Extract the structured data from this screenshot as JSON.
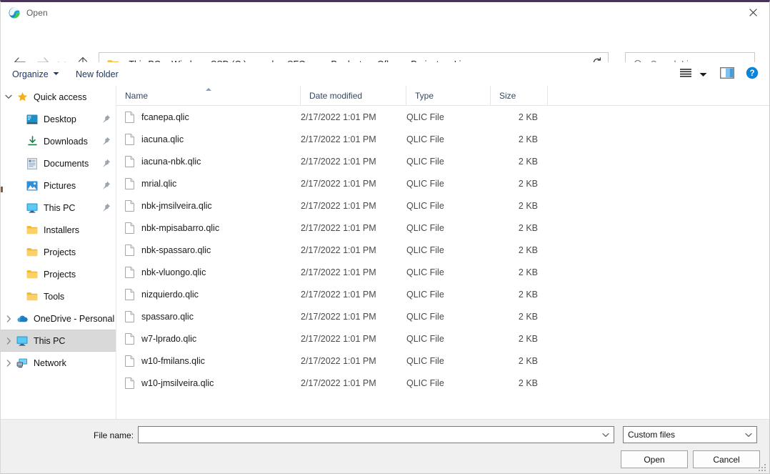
{
  "window": {
    "title": "Open",
    "app_icon": "edge-icon",
    "close_label": "✕"
  },
  "nav": {
    "back_icon": "back-arrow-icon",
    "forward_icon": "forward-arrow-icon",
    "recent_icon": "chevron-down-icon",
    "up_icon": "up-arrow-icon"
  },
  "address": {
    "folder_icon": "folder-icon",
    "crumbs": [
      "This PC",
      "Windows-SSD (C:)",
      "work",
      "SFQexp",
      "Products",
      "Qflow",
      "Projects",
      "Licenses"
    ],
    "separator": "›",
    "dropdown_icon": "chevron-down-icon",
    "refresh_icon": "refresh-icon"
  },
  "search": {
    "placeholder": "Search Licenses",
    "icon": "search-icon"
  },
  "commandbar": {
    "organize_label": "Organize",
    "organize_caret": "▼",
    "new_folder_label": "New folder",
    "view_icon": "list-view-icon",
    "view_caret_icon": "chevron-down-icon",
    "preview_pane_icon": "preview-pane-icon",
    "help_icon": "help-icon"
  },
  "sidebar": {
    "items": [
      {
        "label": "Quick access",
        "icon": "star-icon",
        "expander": "⌄",
        "expanded": true,
        "indent": 0,
        "pinned": false,
        "selected": false
      },
      {
        "label": "Desktop",
        "icon": "desktop-icon",
        "expander": "",
        "indent": 1,
        "pinned": true,
        "selected": false
      },
      {
        "label": "Downloads",
        "icon": "downloads-icon",
        "expander": "",
        "indent": 1,
        "pinned": true,
        "selected": false
      },
      {
        "label": "Documents",
        "icon": "documents-icon",
        "expander": "",
        "indent": 1,
        "pinned": true,
        "selected": false
      },
      {
        "label": "Pictures",
        "icon": "pictures-icon",
        "expander": "",
        "indent": 1,
        "pinned": true,
        "selected": false
      },
      {
        "label": "This PC",
        "icon": "monitor-icon",
        "expander": "",
        "indent": 1,
        "pinned": true,
        "selected": false
      },
      {
        "label": "Installers",
        "icon": "folder-icon",
        "expander": "",
        "indent": 1,
        "pinned": false,
        "selected": false
      },
      {
        "label": "Projects",
        "icon": "folder-icon",
        "expander": "",
        "indent": 1,
        "pinned": false,
        "selected": false
      },
      {
        "label": "Projects",
        "icon": "folder-icon",
        "expander": "",
        "indent": 1,
        "pinned": false,
        "selected": false
      },
      {
        "label": "Tools",
        "icon": "folder-icon",
        "expander": "",
        "indent": 1,
        "pinned": false,
        "selected": false
      },
      {
        "label": "OneDrive - Personal",
        "icon": "onedrive-icon",
        "expander": "›",
        "indent": 0,
        "pinned": false,
        "selected": false
      },
      {
        "label": "This PC",
        "icon": "monitor-icon",
        "expander": "›",
        "indent": 0,
        "pinned": false,
        "selected": true
      },
      {
        "label": "Network",
        "icon": "network-icon",
        "expander": "›",
        "indent": 0,
        "pinned": false,
        "selected": false
      }
    ]
  },
  "filelist": {
    "columns": [
      {
        "label": "Name",
        "sorted": true,
        "sort_dir": "asc"
      },
      {
        "label": "Date modified",
        "sorted": false
      },
      {
        "label": "Type",
        "sorted": false
      },
      {
        "label": "Size",
        "sorted": false
      }
    ],
    "rows": [
      {
        "name": "fcanepa.qlic",
        "date": "2/17/2022 1:01 PM",
        "type": "QLIC File",
        "size": "2 KB"
      },
      {
        "name": "iacuna.qlic",
        "date": "2/17/2022 1:01 PM",
        "type": "QLIC File",
        "size": "2 KB"
      },
      {
        "name": "iacuna-nbk.qlic",
        "date": "2/17/2022 1:01 PM",
        "type": "QLIC File",
        "size": "2 KB"
      },
      {
        "name": "mrial.qlic",
        "date": "2/17/2022 1:01 PM",
        "type": "QLIC File",
        "size": "2 KB"
      },
      {
        "name": "nbk-jmsilveira.qlic",
        "date": "2/17/2022 1:01 PM",
        "type": "QLIC File",
        "size": "2 KB"
      },
      {
        "name": "nbk-mpisabarro.qlic",
        "date": "2/17/2022 1:01 PM",
        "type": "QLIC File",
        "size": "2 KB"
      },
      {
        "name": "nbk-spassaro.qlic",
        "date": "2/17/2022 1:01 PM",
        "type": "QLIC File",
        "size": "2 KB"
      },
      {
        "name": "nbk-vluongo.qlic",
        "date": "2/17/2022 1:01 PM",
        "type": "QLIC File",
        "size": "2 KB"
      },
      {
        "name": "nizquierdo.qlic",
        "date": "2/17/2022 1:01 PM",
        "type": "QLIC File",
        "size": "2 KB"
      },
      {
        "name": "spassaro.qlic",
        "date": "2/17/2022 1:01 PM",
        "type": "QLIC File",
        "size": "2 KB"
      },
      {
        "name": "w7-lprado.qlic",
        "date": "2/17/2022 1:01 PM",
        "type": "QLIC File",
        "size": "2 KB"
      },
      {
        "name": "w10-fmilans.qlic",
        "date": "2/17/2022 1:01 PM",
        "type": "QLIC File",
        "size": "2 KB"
      },
      {
        "name": "w10-jmsilveira.qlic",
        "date": "2/17/2022 1:01 PM",
        "type": "QLIC File",
        "size": "2 KB"
      }
    ]
  },
  "footer": {
    "filename_label": "File name:",
    "filename_value": "",
    "filename_placeholder": "",
    "filename_chevron": "chevron-down-icon",
    "filter_value": "Custom files",
    "filter_chevron": "chevron-down-icon",
    "open_label": "Open",
    "cancel_label": "Cancel",
    "resize_grip": "resize-grip-icon"
  },
  "colors": {
    "accent_border": "#4a3358",
    "command_text": "#1f3864",
    "selection": "#d9d9d9",
    "folder": "#f7c85a",
    "help_blue": "#0a84d8"
  }
}
